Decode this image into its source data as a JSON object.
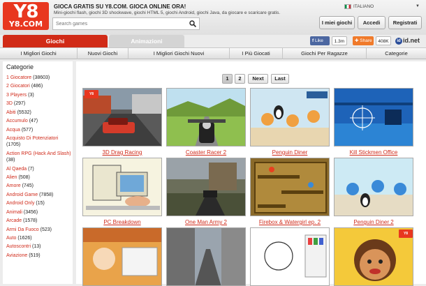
{
  "header": {
    "logo_top": "Y8",
    "logo_bottom": "Y8.COM",
    "tagline": "GIOCA GRATIS SU Y8.COM. GIOCA ONLINE ORA!",
    "subtagline": "Mini-giochi flash, giochi 3D shockwave, giochi HTML 5, giochi Android, giochi Java, da giocare e scaricare gratis.",
    "search_placeholder": "Search games",
    "language": "ITALIANO",
    "buttons": {
      "my_games": "I miei giochi",
      "login": "Accedi",
      "register": "Registrati"
    }
  },
  "tabs": {
    "games": "Giochi",
    "animations": "Animazioni"
  },
  "social": {
    "like": "Like",
    "like_count": "1.3m",
    "share": "Share",
    "share_count": "408K",
    "idnet": "id.net"
  },
  "nav": [
    "I Migliori Giochi",
    "Nuovi Giochi",
    "I Migliori Giochi Nuovi",
    "I Più Giocati",
    "Giochi Per Ragazze",
    "Categorie"
  ],
  "sidebar": {
    "title": "Categorie",
    "categories": [
      {
        "name": "1 Giocatore",
        "count": "(38603)"
      },
      {
        "name": "2 Giocatori",
        "count": "(486)"
      },
      {
        "name": "3 Players",
        "count": "(3)"
      },
      {
        "name": "3D",
        "count": "(297)"
      },
      {
        "name": "Abiti",
        "count": "(5532)"
      },
      {
        "name": "Accumulo",
        "count": "(47)"
      },
      {
        "name": "Acqua",
        "count": "(577)"
      },
      {
        "name": "Acquisto Di Potenziatori",
        "count": "(1705)"
      },
      {
        "name": "Action RPG (Hack And Slash)",
        "count": "(38)"
      },
      {
        "name": "Al Qaeda",
        "count": "(7)"
      },
      {
        "name": "Alien",
        "count": "(508)"
      },
      {
        "name": "Amore",
        "count": "(745)"
      },
      {
        "name": "Android Game",
        "count": "(7858)"
      },
      {
        "name": "Android Only",
        "count": "(15)"
      },
      {
        "name": "Animali",
        "count": "(3456)"
      },
      {
        "name": "Arcade",
        "count": "(1578)"
      },
      {
        "name": "Armi Da Fuoco",
        "count": "(523)"
      },
      {
        "name": "Auto",
        "count": "(1626)"
      },
      {
        "name": "Autoscontri",
        "count": "(13)"
      },
      {
        "name": "Aviazione",
        "count": "(519)"
      }
    ]
  },
  "pagination": {
    "page1": "1",
    "page2": "2",
    "next": "Next",
    "last": "Last"
  },
  "games": [
    {
      "title": "3D Drag Racing",
      "icon": "car-racing-icon"
    },
    {
      "title": "Coaster Racer 2",
      "icon": "motorbike-icon"
    },
    {
      "title": "Penguin Diner",
      "icon": "penguin-icon"
    },
    {
      "title": "Kill Stickmen Office",
      "icon": "crosshair-icon"
    },
    {
      "title": "PC Breakdown",
      "icon": "computer-icon"
    },
    {
      "title": "One Man Army 2",
      "icon": "gun-icon"
    },
    {
      "title": "Firebox & Watergirl ep. 2",
      "icon": "maze-icon"
    },
    {
      "title": "Penguin Diner 2",
      "icon": "penguin-icon"
    },
    {
      "title": "",
      "icon": "cooking-icon"
    },
    {
      "title": "",
      "icon": "street-icon"
    },
    {
      "title": "",
      "icon": "dora-coloring-icon"
    },
    {
      "title": "",
      "icon": "dora-dentist-icon"
    }
  ]
}
